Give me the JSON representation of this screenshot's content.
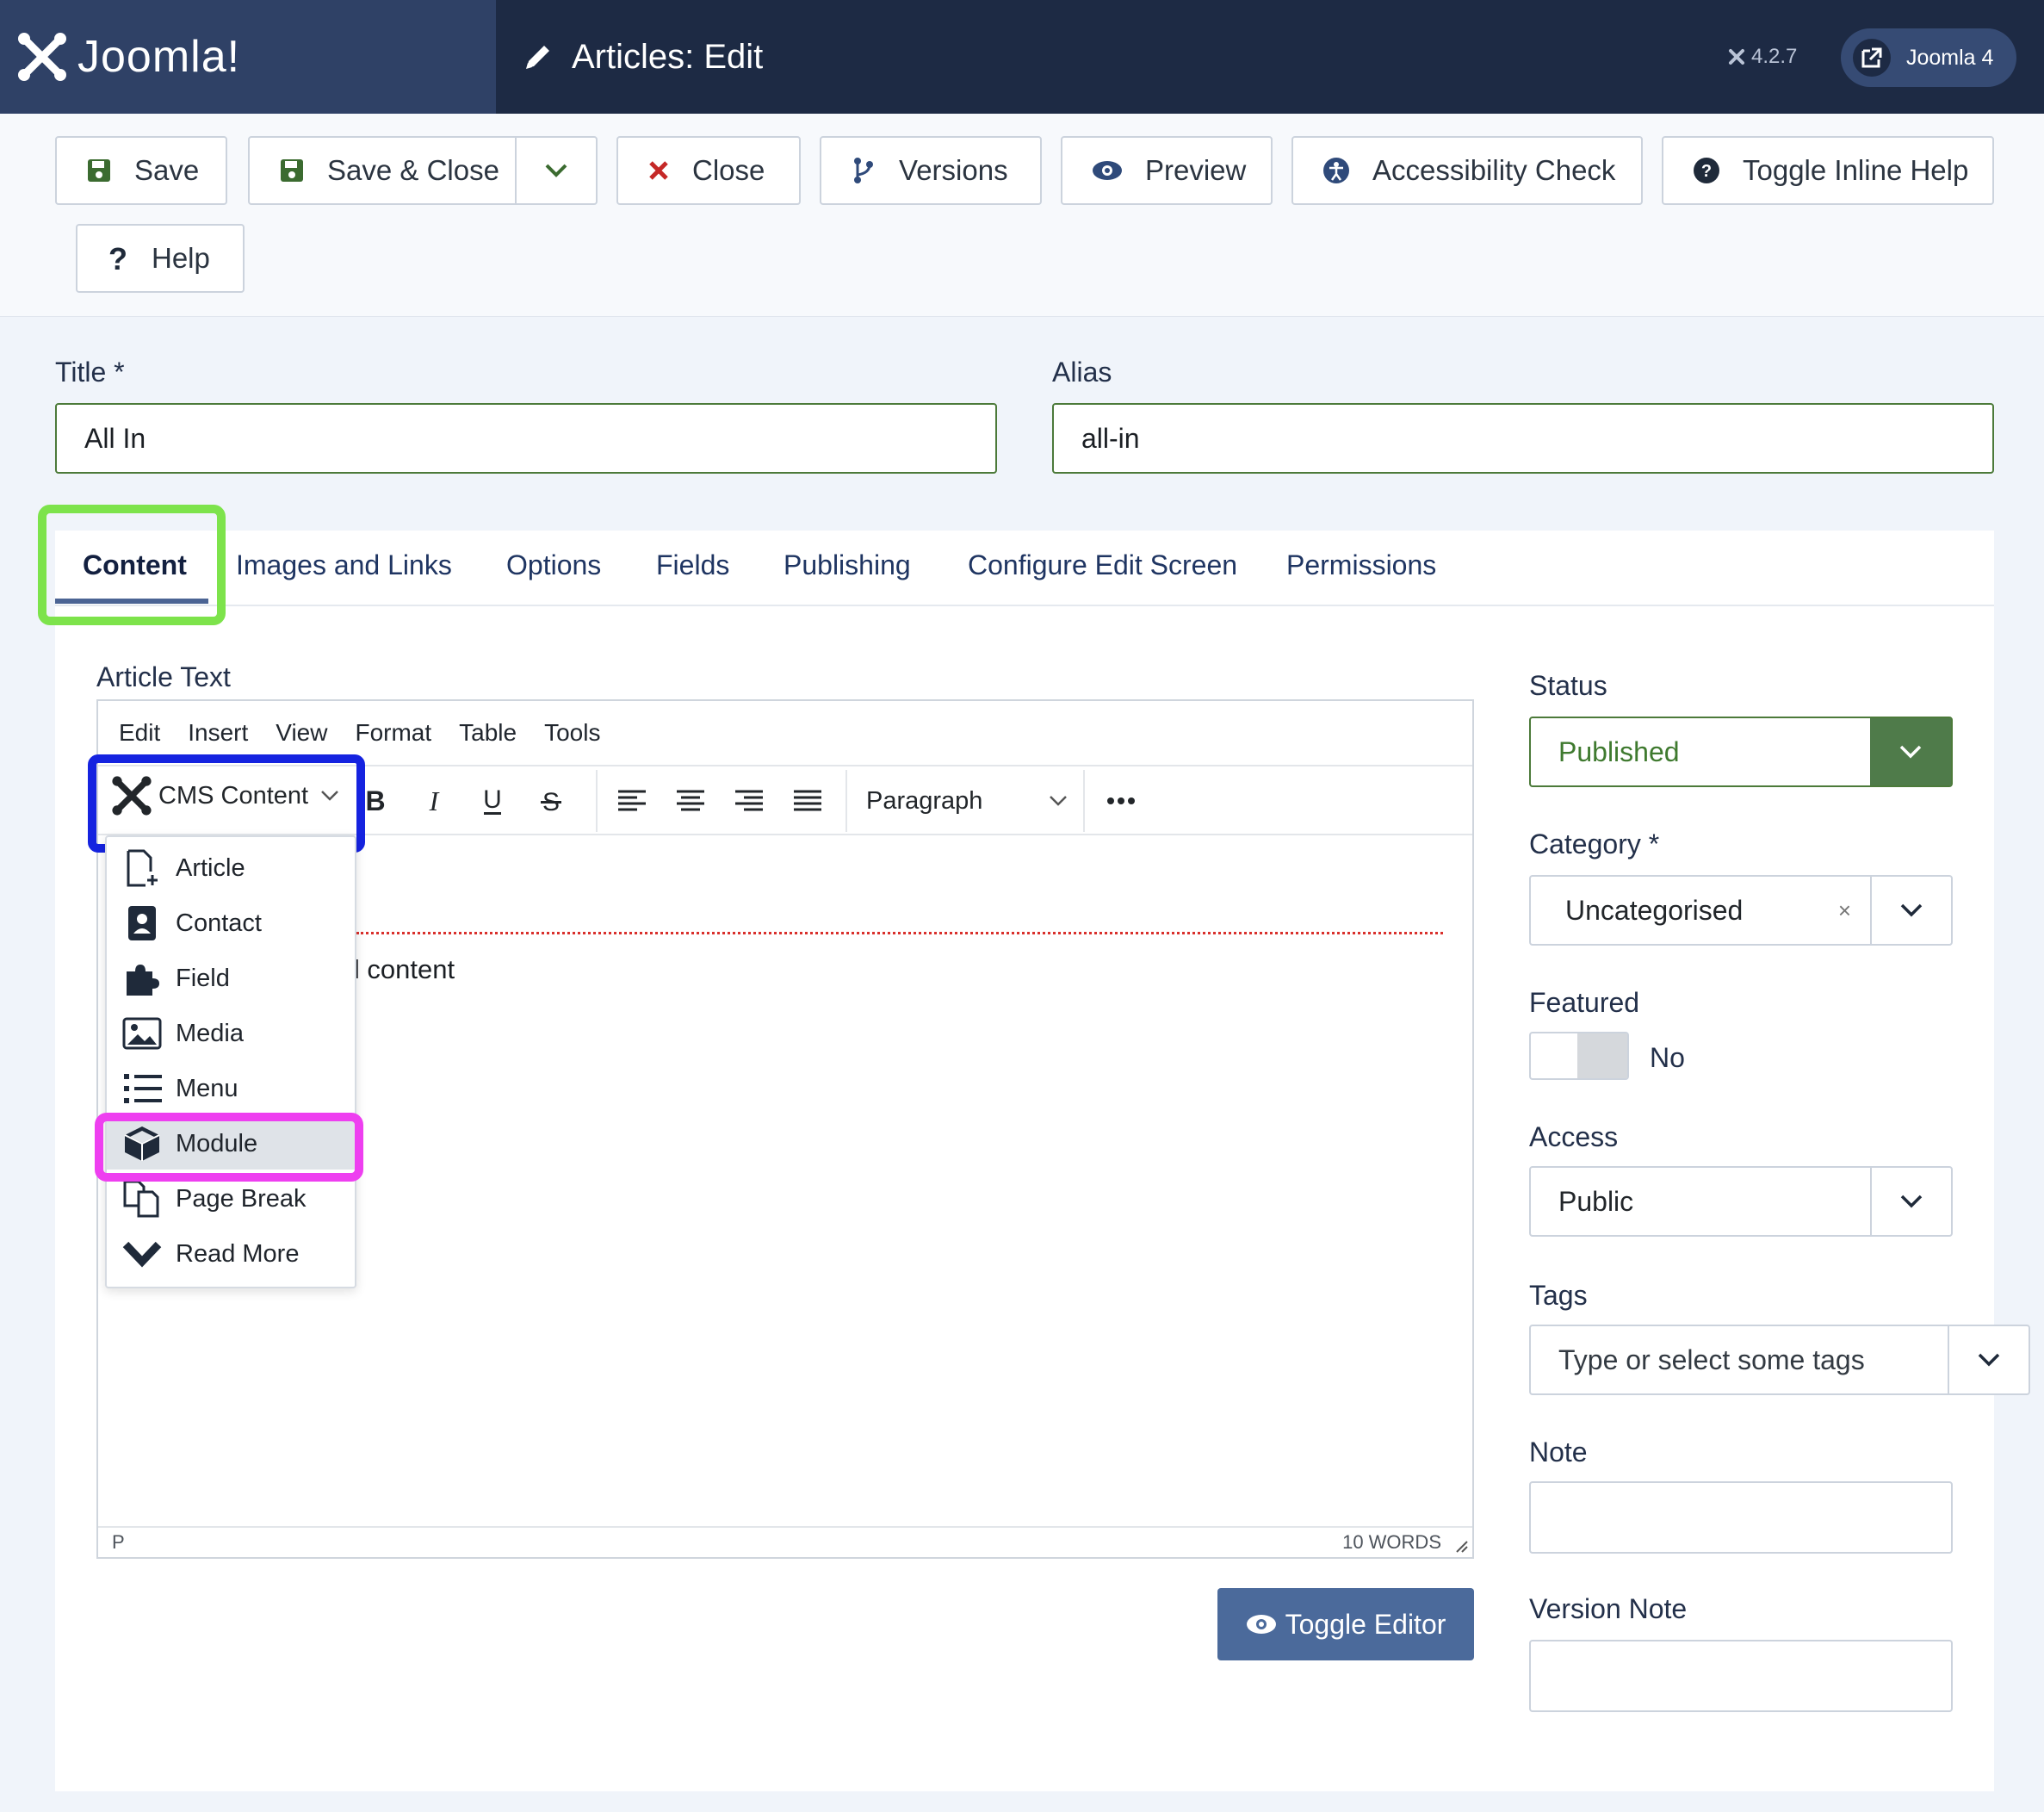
{
  "header": {
    "brand": "Joomla!",
    "page_title": "Articles: Edit",
    "version": "4.2.7",
    "user_menu_label": "Joomla 4"
  },
  "toolbar": {
    "save": "Save",
    "save_close": "Save & Close",
    "close": "Close",
    "versions": "Versions",
    "preview": "Preview",
    "accessibility_check": "Accessibility Check",
    "toggle_inline_help": "Toggle Inline Help",
    "help": "Help"
  },
  "form": {
    "title_label": "Title *",
    "title_value": "All In",
    "alias_label": "Alias",
    "alias_value": "all-in"
  },
  "tabs": [
    "Content",
    "Images and Links",
    "Options",
    "Fields",
    "Publishing",
    "Configure Edit Screen",
    "Permissions"
  ],
  "editor": {
    "label": "Article Text",
    "menu": [
      "Edit",
      "Insert",
      "View",
      "Format",
      "Table",
      "Tools"
    ],
    "cms_content_label": "CMS Content",
    "block_format": "Paragraph",
    "content_text": "ll content",
    "path": "P",
    "word_count": "10 WORDS",
    "toggle_editor": "Toggle Editor",
    "dropdown_items": [
      "Article",
      "Contact",
      "Field",
      "Media",
      "Menu",
      "Module",
      "Page Break",
      "Read More"
    ],
    "selected_item": "Module"
  },
  "sidebar": {
    "status_label": "Status",
    "status_value": "Published",
    "category_label": "Category *",
    "category_value": "Uncategorised",
    "category_clear": "×",
    "featured_label": "Featured",
    "featured_value": "No",
    "access_label": "Access",
    "access_value": "Public",
    "tags_label": "Tags",
    "tags_placeholder": "Type or select some tags",
    "note_label": "Note",
    "version_note_label": "Version Note"
  },
  "colors": {
    "header_bg": "#1d2a44",
    "logo_bg": "#2f4166",
    "status_green": "#4f7b4a",
    "highlight_green": "#7de34b",
    "highlight_blue": "#1523e0",
    "highlight_pink": "#ee3ff0",
    "toggle_editor_bg": "#4b6a9b"
  }
}
